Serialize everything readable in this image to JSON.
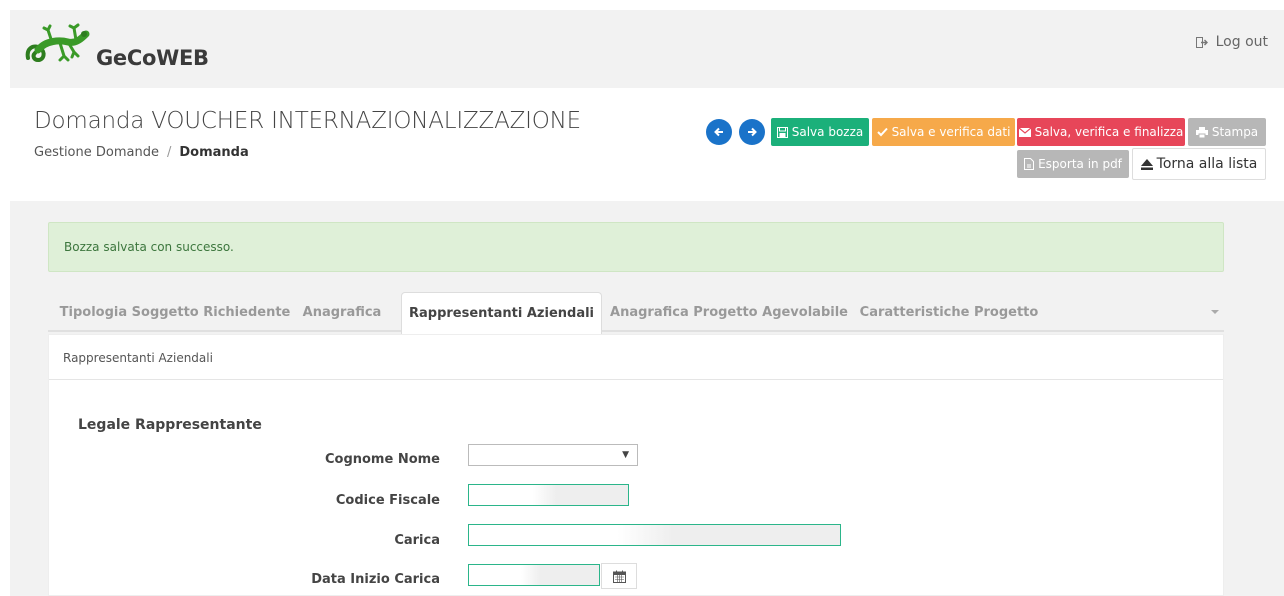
{
  "header": {
    "app_name": "GeCoWEB",
    "logout_label": "Log out"
  },
  "page": {
    "title": "Domanda VOUCHER INTERNAZIONALIZZAZIONE",
    "breadcrumb": [
      "Gestione Domande",
      "Domanda"
    ],
    "breadcrumb_sep": "/"
  },
  "toolbar": {
    "save_draft": "Salva bozza",
    "save_verify": "Salva e verifica dati",
    "save_verify_finalize": "Salva, verifica e finalizza",
    "print": "Stampa",
    "export_pdf": "Esporta in pdf",
    "back_to_list": "Torna alla lista"
  },
  "alert": {
    "message": "Bozza salvata con successo."
  },
  "tabs": [
    {
      "label": "Tipologia Soggetto Richiedente"
    },
    {
      "label": "Anagrafica"
    },
    {
      "label": "Rappresentanti Aziendali"
    },
    {
      "label": "Anagrafica Progetto Agevolabile"
    },
    {
      "label": "Caratteristiche Progetto"
    }
  ],
  "panel": {
    "header": "Rappresentanti Aziendali",
    "section_title": "Legale Rappresentante",
    "fields": {
      "cognome_nome": "Cognome Nome",
      "codice_fiscale": "Codice Fiscale",
      "carica": "Carica",
      "data_inizio_carica": "Data Inizio Carica"
    }
  },
  "colors": {
    "primary_blue": "#1a73c9",
    "green": "#1bb07a",
    "orange": "#f6a94a",
    "red": "#e74659",
    "gray": "#b7b7b7",
    "alert_bg": "#dff0d8",
    "field_border": "#2bb58a"
  }
}
